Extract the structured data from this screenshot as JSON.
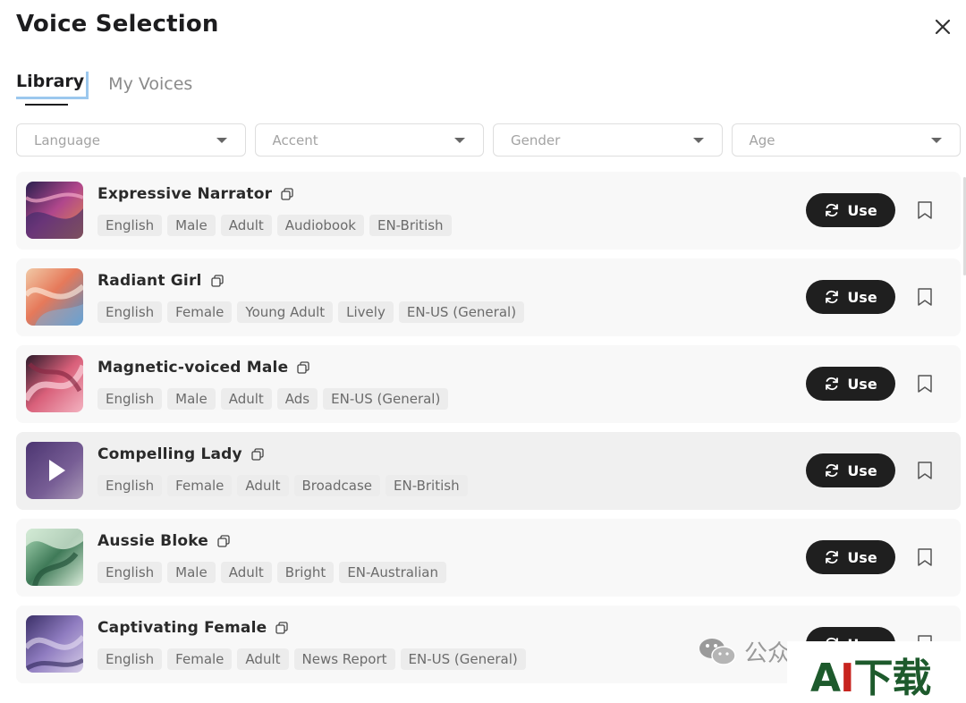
{
  "dialog": {
    "title": "Voice Selection"
  },
  "tabs": [
    {
      "label": "Library"
    },
    {
      "label": "My Voices"
    }
  ],
  "filters": [
    {
      "placeholder": "Language"
    },
    {
      "placeholder": "Accent"
    },
    {
      "placeholder": "Gender"
    },
    {
      "placeholder": "Age"
    }
  ],
  "voices": [
    {
      "name": "Expressive Narrator",
      "tags": [
        "English",
        "Male",
        "Adult",
        "Audiobook",
        "EN-British"
      ],
      "use_label": "Use"
    },
    {
      "name": "Radiant Girl",
      "tags": [
        "English",
        "Female",
        "Young Adult",
        "Lively",
        "EN-US (General)"
      ],
      "use_label": "Use"
    },
    {
      "name": "Magnetic-voiced Male",
      "tags": [
        "English",
        "Male",
        "Adult",
        "Ads",
        "EN-US (General)"
      ],
      "use_label": "Use"
    },
    {
      "name": "Compelling Lady",
      "tags": [
        "English",
        "Female",
        "Adult",
        "Broadcase",
        "EN-British"
      ],
      "use_label": "Use"
    },
    {
      "name": "Aussie Bloke",
      "tags": [
        "English",
        "Male",
        "Adult",
        "Bright",
        "EN-Australian"
      ],
      "use_label": "Use"
    },
    {
      "name": "Captivating Female",
      "tags": [
        "English",
        "Female",
        "Adult",
        "News Report",
        "EN-US (General)"
      ],
      "use_label": "Use"
    }
  ],
  "watermark": {
    "account": "公众",
    "logo_a": "A",
    "logo_i": "I",
    "logo_cn": "下载"
  },
  "colors": {
    "primary_button": "#1f1f1f",
    "tab_focus": "#9cc8ee",
    "tag_bg": "#ececec"
  }
}
